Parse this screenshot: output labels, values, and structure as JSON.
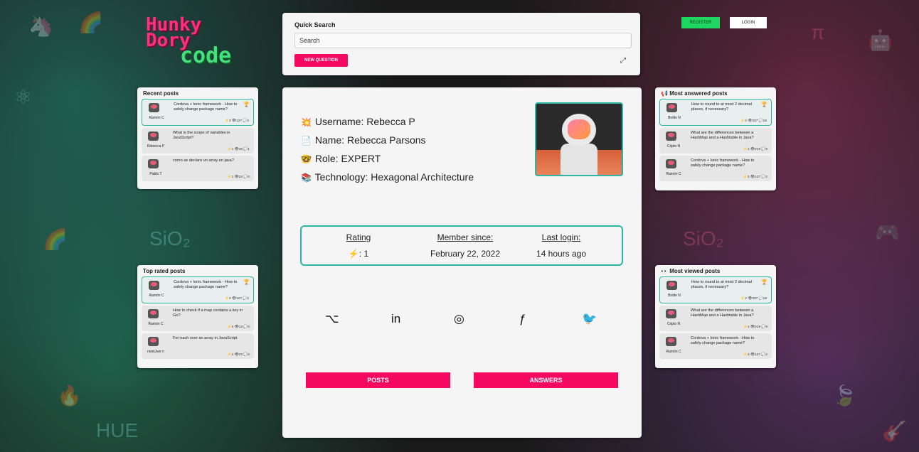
{
  "logo": {
    "line1": "Hunky",
    "line2": "Dory",
    "line3": "code"
  },
  "search": {
    "title": "Quick Search",
    "placeholder": "Search",
    "new_question": "NEW QUESTION"
  },
  "auth": {
    "register": "REGISTER",
    "login": "LOGIN"
  },
  "profile": {
    "username_label": "Username:",
    "username": "Rebecca P",
    "name_label": "Name:",
    "name": "Rebecca Parsons",
    "role_label": "Role:",
    "role": "EXPERT",
    "technology_label": "Technology:",
    "technology": "Hexagonal Architecture",
    "stats": {
      "rating_label": "Rating",
      "rating_value": ": 1",
      "member_label": "Member since:",
      "member_value": "February 22, 2022",
      "login_label": "Last login:",
      "login_value": "14 hours ago"
    },
    "posts_button": "POSTS",
    "answers_button": "ANSWERS"
  },
  "recent": {
    "title": "Recent posts",
    "items": [
      {
        "user": "Ramón C",
        "q": "Cordova + Ionic framework - How to safely change package name?",
        "meta": "⚡3 👁127 💬2",
        "badge": "🏆"
      },
      {
        "user": "Rebecca P",
        "q": "What is the scope of variables in JavaScript?",
        "meta": "⚡1 👁46 💬1",
        "badge": ""
      },
      {
        "user": "Pablo T",
        "q": "como se declara un array en java?",
        "meta": "⚡1 👁24 💬0",
        "badge": ""
      }
    ]
  },
  "toprated": {
    "title": "Top rated posts",
    "items": [
      {
        "user": "Ramón C",
        "q": "Cordova + Ionic framework - How to safely change package name?",
        "meta": "⚡3 👁127 💬2",
        "badge": "🏆"
      },
      {
        "user": "Ramón C",
        "q": "How to check if a map contains a key in Go?",
        "meta": "⚡3 👁13 💬0",
        "badge": ""
      },
      {
        "user": "newUser n",
        "q": "For-each over an array in JavaScript",
        "meta": "⚡2 👁23 💬0",
        "badge": ""
      }
    ]
  },
  "answered": {
    "title": "Most answered posts",
    "items": [
      {
        "user": "Bottle N",
        "q": "How to round to at most 2 decimal places, if necessary?",
        "meta": "⚡2 👁337 💬18",
        "badge": "🏆"
      },
      {
        "user": "Cripto N",
        "q": "What are the differences between a HashMap and a Hashtable in Java?",
        "meta": "⚡1 👁219 💬9",
        "badge": ""
      },
      {
        "user": "Ramón C",
        "q": "Cordova + Ionic framework - How to safely change package name?",
        "meta": "⚡3 👁127 💬2",
        "badge": ""
      }
    ]
  },
  "viewed": {
    "title": "Most viewed posts",
    "items": [
      {
        "user": "Bottle N",
        "q": "How to round to at most 2 decimal places, if necessary?",
        "meta": "⚡2 👁337 💬18",
        "badge": "🏆"
      },
      {
        "user": "Cripto N",
        "q": "What are the differences between a HashMap and a Hashtable in Java?",
        "meta": "⚡1 👁219 💬9",
        "badge": ""
      },
      {
        "user": "Ramón C",
        "q": "Cordova + Ionic framework - How to safely change package name?",
        "meta": "⚡3 👁127 💬2",
        "badge": ""
      }
    ]
  },
  "icons": {
    "username": "💥",
    "name": "📄",
    "role": "🤓",
    "technology": "📚",
    "rating_bolt": "⚡",
    "answered": "📢",
    "viewed": "👀",
    "github": "⌥",
    "linkedin": "in",
    "instagram": "◎",
    "facebook": "ƒ",
    "twitter": "🐦"
  }
}
